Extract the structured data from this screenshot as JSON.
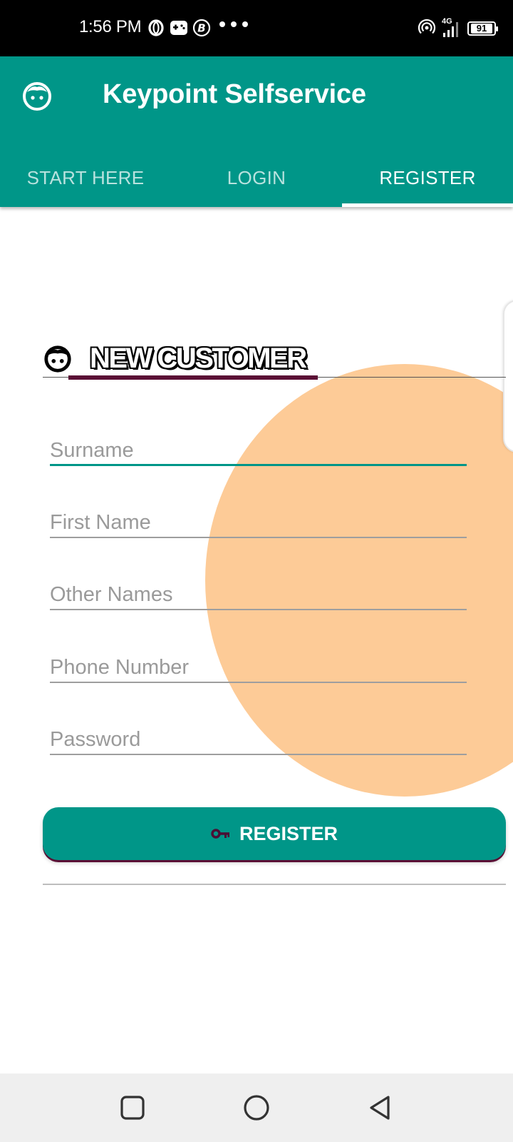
{
  "status_bar": {
    "time": "1:56 PM",
    "network": "4G",
    "battery": "91",
    "icons": [
      "opera-icon",
      "gamepad-icon",
      "b-badge-icon",
      "more-dots-icon",
      "hotspot-icon",
      "signal-icon",
      "battery-icon"
    ]
  },
  "app_bar": {
    "title": "Keypoint Selfservice",
    "icon": "face-icon",
    "tabs": [
      {
        "label": "START HERE",
        "active": false
      },
      {
        "label": "LOGIN",
        "active": false
      },
      {
        "label": "REGISTER",
        "active": true
      }
    ]
  },
  "form": {
    "heading": "NEW CUSTOMER",
    "heading_icon": "face-icon",
    "fields": [
      {
        "placeholder": "Surname",
        "value": ""
      },
      {
        "placeholder": "First Name",
        "value": ""
      },
      {
        "placeholder": "Other Names",
        "value": ""
      },
      {
        "placeholder": "Phone Number",
        "value": ""
      },
      {
        "placeholder": "Password",
        "value": ""
      }
    ],
    "submit_label": "REGISTER",
    "submit_icon": "key-icon"
  },
  "nav_bar": {
    "buttons": [
      "recents-square-icon",
      "home-circle-icon",
      "back-triangle-icon"
    ]
  },
  "colors": {
    "primary": "#009688",
    "accent": "#5a0f35",
    "blob": "#fdcb97",
    "status_bar": "#000000",
    "nav_bar": "#efefef"
  }
}
